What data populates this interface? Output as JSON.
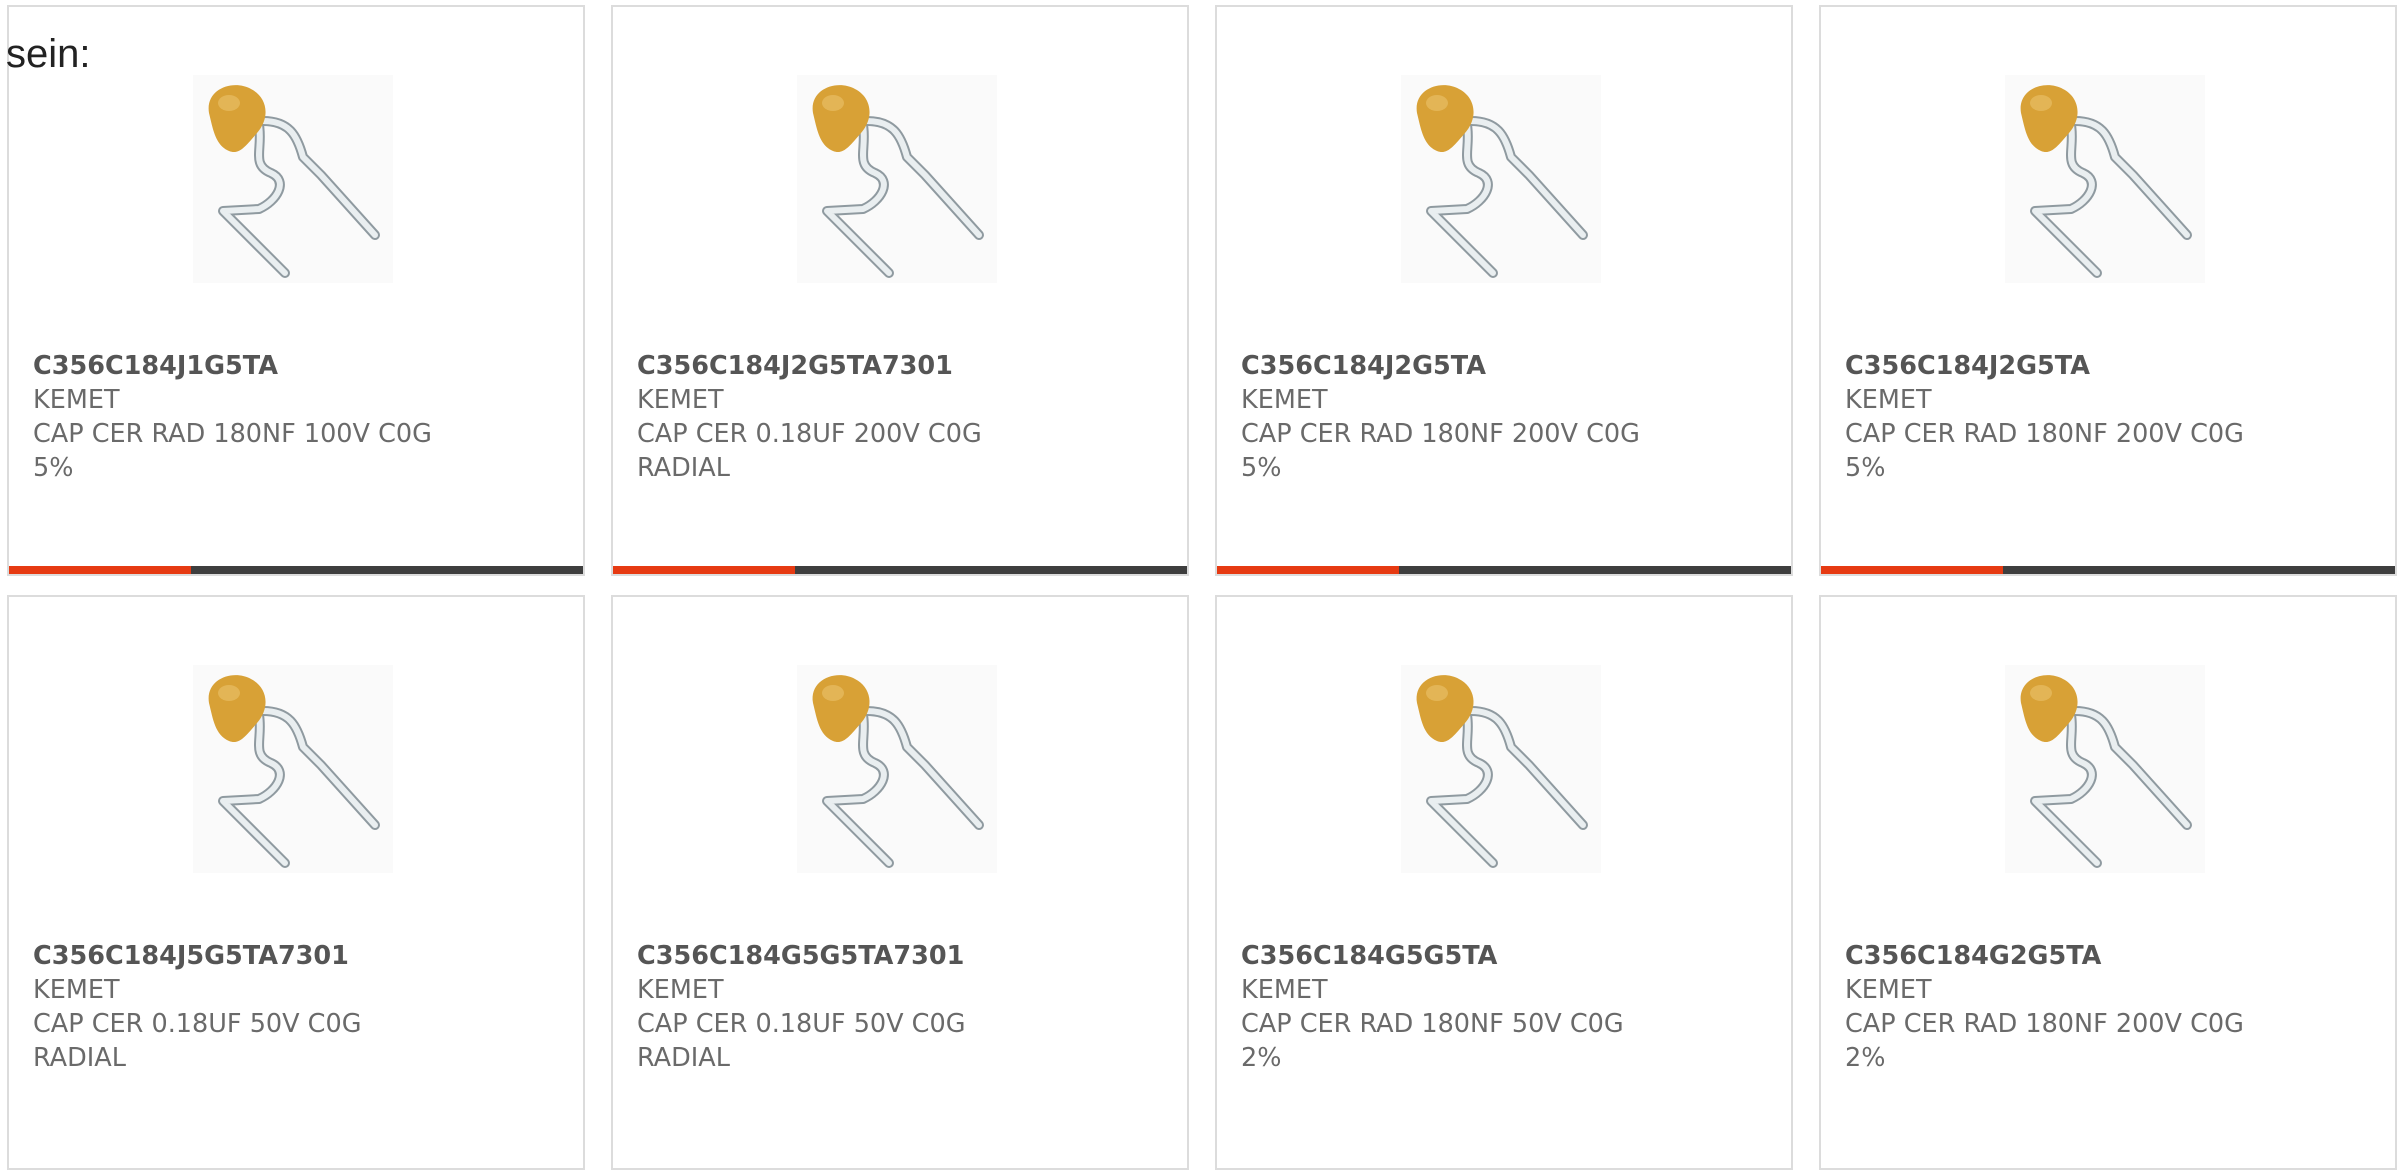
{
  "header": {
    "prefix_text": "sein:"
  },
  "colors": {
    "accent": "#e63a12",
    "bar_dark": "#3e3e3e",
    "text": "#6a6a6a",
    "border": "#dcdcdc",
    "capacitor_body": "#d8a136"
  },
  "product_image": {
    "icon": "radial-ceramic-capacitor-icon"
  },
  "products": [
    {
      "part_number": "C356C184J1G5TA",
      "manufacturer": "KEMET",
      "description_line1": "CAP CER RAD 180NF 100V C0G",
      "description_line2": "5%"
    },
    {
      "part_number": "C356C184J2G5TA7301",
      "manufacturer": "KEMET",
      "description_line1": "CAP CER 0.18UF 200V C0G",
      "description_line2": "RADIAL"
    },
    {
      "part_number": "C356C184J2G5TA",
      "manufacturer": "KEMET",
      "description_line1": "CAP CER RAD 180NF 200V C0G",
      "description_line2": "5%"
    },
    {
      "part_number": "C356C184J2G5TA",
      "manufacturer": "KEMET",
      "description_line1": "CAP CER RAD 180NF 200V C0G",
      "description_line2": "5%"
    },
    {
      "part_number": "C356C184J5G5TA7301",
      "manufacturer": "KEMET",
      "description_line1": "CAP CER 0.18UF 50V C0G",
      "description_line2": "RADIAL"
    },
    {
      "part_number": "C356C184G5G5TA7301",
      "manufacturer": "KEMET",
      "description_line1": "CAP CER 0.18UF 50V C0G",
      "description_line2": "RADIAL"
    },
    {
      "part_number": "C356C184G5G5TA",
      "manufacturer": "KEMET",
      "description_line1": "CAP CER RAD 180NF 50V C0G",
      "description_line2": "2%"
    },
    {
      "part_number": "C356C184G2G5TA",
      "manufacturer": "KEMET",
      "description_line1": "CAP CER RAD 180NF 200V C0G",
      "description_line2": "2%"
    }
  ]
}
